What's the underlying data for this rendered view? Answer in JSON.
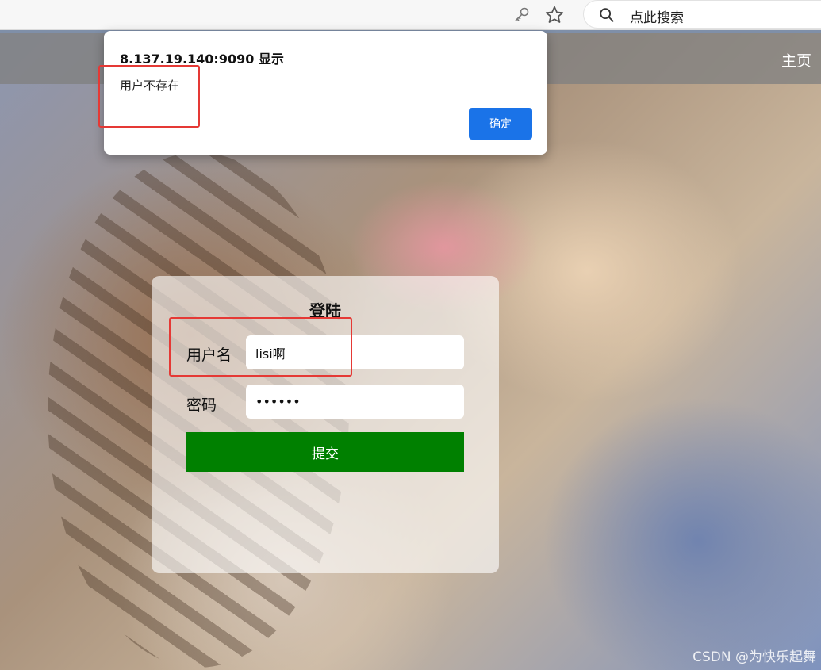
{
  "browser": {
    "search_placeholder": "点此搜索",
    "key_icon": "key-icon",
    "star_icon": "star-icon",
    "search_icon": "search-icon"
  },
  "nav": {
    "home_label": "主页"
  },
  "login": {
    "title": "登陆",
    "username_label": "用户名",
    "username_value": "lisi啊",
    "password_label": "密码",
    "password_value": "••••••",
    "submit_label": "提交",
    "submit_color": "#008000"
  },
  "alert": {
    "title": "8.137.19.140:9090 显示",
    "message": "用户不存在",
    "ok_label": "确定",
    "ok_color": "#1a73e8"
  },
  "annotation_color": "#e53935",
  "watermark": "CSDN @为快乐起舞"
}
